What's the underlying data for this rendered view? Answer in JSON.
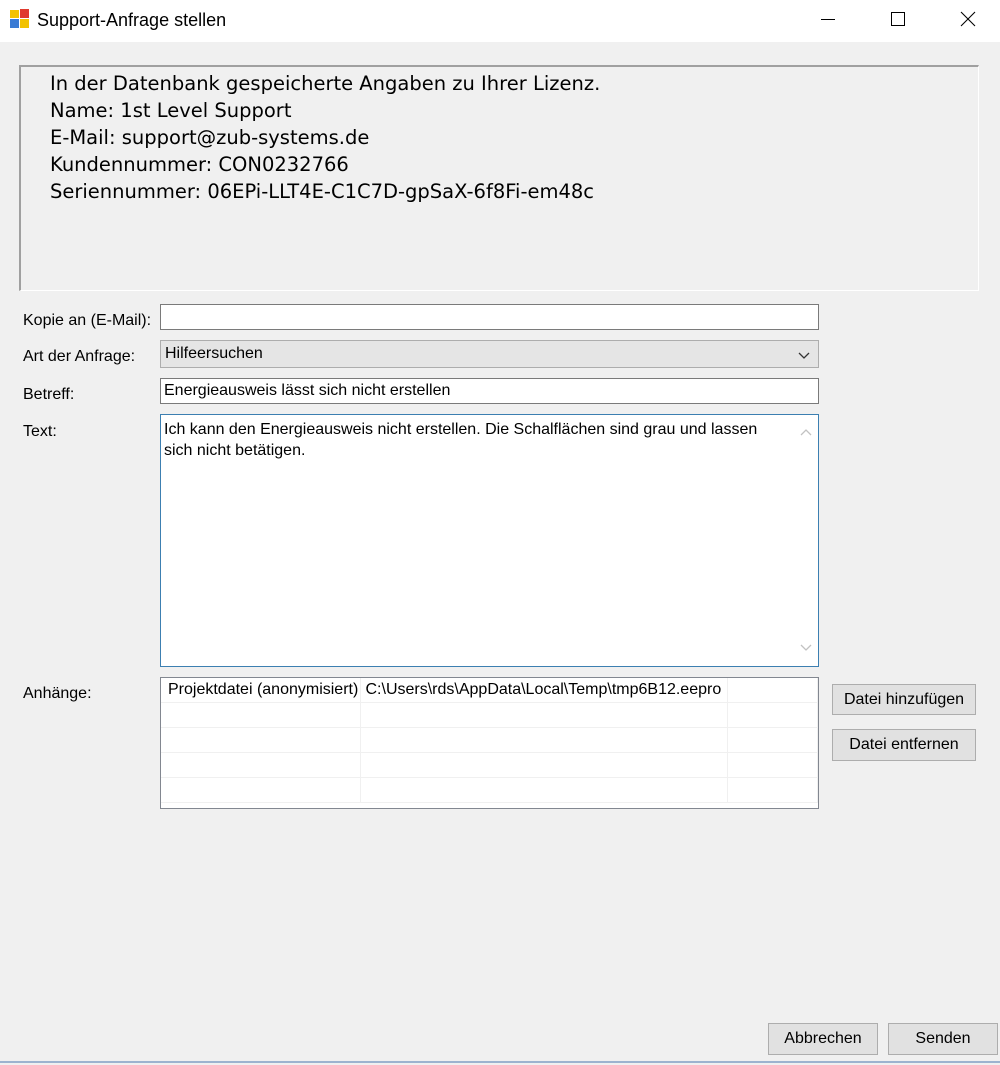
{
  "window": {
    "title": "Support-Anfrage stellen",
    "icon": "app-icon",
    "controls": {
      "minimize": "minimize-icon",
      "maximize": "maximize-icon",
      "close": "close-icon"
    }
  },
  "license_info": {
    "lines": [
      "In der Datenbank gespeicherte Angaben zu Ihrer Lizenz.",
      "Name: 1st Level Support",
      "E-Mail: support@zub-systems.de",
      "Kundennummer: CON0232766",
      "Seriennummer: 06EPi-LLT4E-C1C7D-gpSaX-6f8Fi-em48c"
    ]
  },
  "form": {
    "copy_label": "Kopie an (E-Mail):",
    "copy_value": "",
    "type_label": "Art der Anfrage:",
    "type_value": "Hilfeersuchen",
    "subject_label": "Betreff:",
    "subject_value": "Energieausweis lässt sich nicht erstellen",
    "text_label": "Text:",
    "text_value": "Ich kann den Energieausweis nicht erstellen. Die Schalflächen sind grau und lassen sich nicht betätigen.",
    "attachments_label": "Anhänge:"
  },
  "attachments": {
    "rows": [
      [
        "Projektdatei (anonymisiert)",
        "C:\\Users\\rds\\AppData\\Local\\Temp\\tmp6B12.eepro",
        ""
      ],
      [
        "",
        "",
        ""
      ],
      [
        "",
        "",
        ""
      ],
      [
        "",
        "",
        ""
      ],
      [
        "",
        "",
        ""
      ]
    ]
  },
  "buttons": {
    "add_file": "Datei hinzufügen",
    "remove_file": "Datei entfernen",
    "cancel": "Abbrechen",
    "send": "Senden"
  },
  "colors": {
    "window_bg": "#f0f0f0",
    "focus_border": "#3c7fb1",
    "button_bg": "#e1e1e1"
  }
}
